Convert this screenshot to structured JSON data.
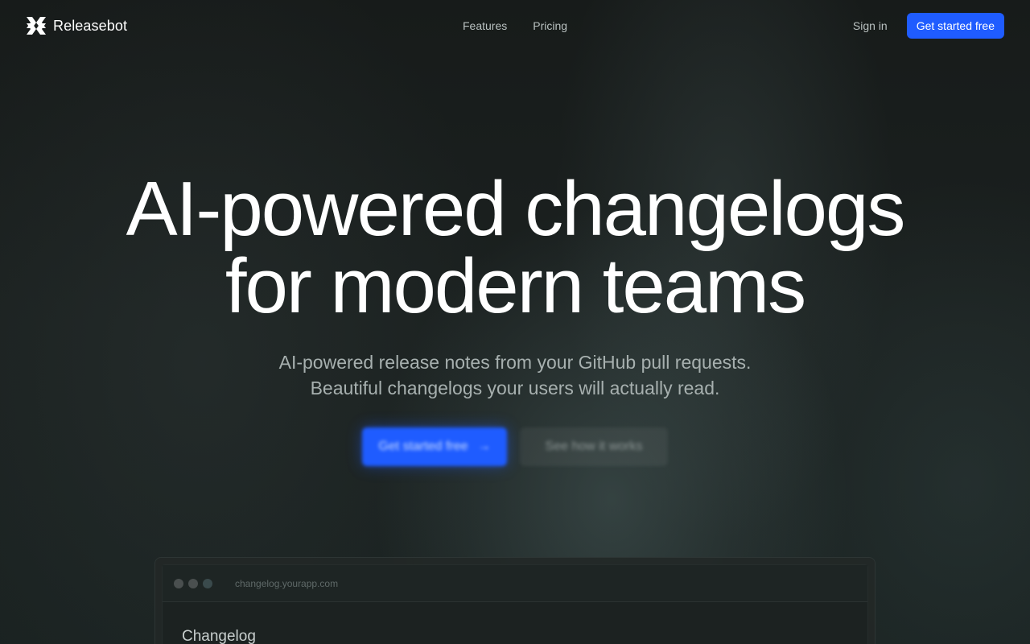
{
  "brand": {
    "name": "Releasebot",
    "logo_icon": "releasebot-logo-icon"
  },
  "nav": {
    "links": [
      {
        "label": "Features"
      },
      {
        "label": "Pricing"
      }
    ],
    "signin_label": "Sign in",
    "cta_label": "Get started free"
  },
  "hero": {
    "headline_line1": "AI-powered changelogs",
    "headline_line2": "for modern teams",
    "sub_line1": "AI-powered release notes from your GitHub pull requests.",
    "sub_line2": "Beautiful changelogs your users will actually read.",
    "primary_cta": "Get started free",
    "primary_cta_icon": "arrow-right-icon",
    "secondary_cta": "See how it works"
  },
  "preview": {
    "url": "changelog.yourapp.com",
    "title": "Changelog",
    "dot_colors": [
      "#4a4f4f",
      "#4a4f4f",
      "#3a4a4c"
    ]
  },
  "colors": {
    "accent": "#1f5cff",
    "background": "#171b1a",
    "text": "#ffffff",
    "muted": "#a7b0af"
  }
}
